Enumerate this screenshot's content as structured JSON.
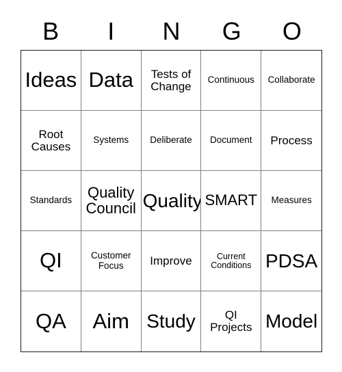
{
  "card": {
    "header_letters": [
      "B",
      "I",
      "N",
      "G",
      "O"
    ],
    "cells": [
      {
        "text": "Ideas",
        "size": "xl"
      },
      {
        "text": "Data",
        "size": "xl"
      },
      {
        "text": "Tests of\nChange",
        "size": "sm"
      },
      {
        "text": "Continuous",
        "size": "xs"
      },
      {
        "text": "Collaborate",
        "size": "xs"
      },
      {
        "text": "Root\nCauses",
        "size": "sm"
      },
      {
        "text": "Systems",
        "size": "xs"
      },
      {
        "text": "Deliberate",
        "size": "xs"
      },
      {
        "text": "Document",
        "size": "xs"
      },
      {
        "text": "Process",
        "size": "sm"
      },
      {
        "text": "Standards",
        "size": "xs"
      },
      {
        "text": "Quality\nCouncil",
        "size": "md"
      },
      {
        "text": "Quality",
        "size": "lg"
      },
      {
        "text": "SMART",
        "size": "md"
      },
      {
        "text": "Measures",
        "size": "xs"
      },
      {
        "text": "QI",
        "size": "xl"
      },
      {
        "text": "Customer\nFocus",
        "size": "xs"
      },
      {
        "text": "Improve",
        "size": "sm"
      },
      {
        "text": "Current\nConditions",
        "size": "xxs"
      },
      {
        "text": "PDSA",
        "size": "lg"
      },
      {
        "text": "QA",
        "size": "xl"
      },
      {
        "text": "Aim",
        "size": "xl"
      },
      {
        "text": "Study",
        "size": "lg"
      },
      {
        "text": "QI\nProjects",
        "size": "sm"
      },
      {
        "text": "Model",
        "size": "lg"
      }
    ],
    "colors": {
      "background": "#ffffff",
      "text": "#000000",
      "outer_border": "#1a1a1a",
      "inner_border": "#808080"
    }
  }
}
